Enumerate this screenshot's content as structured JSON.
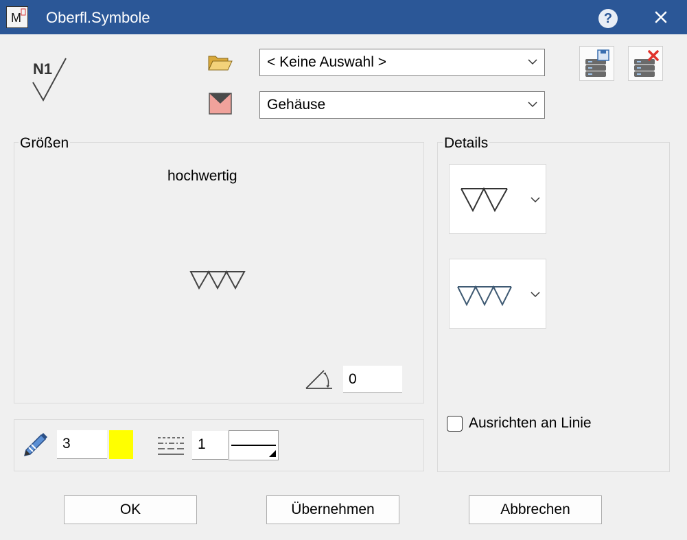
{
  "window": {
    "title": "Oberfl.Symbole",
    "help_label": "?"
  },
  "symbol_preview": {
    "label": "N1"
  },
  "selection": {
    "value": "< Keine Auswahl >"
  },
  "material": {
    "value": "Gehäuse"
  },
  "groups": {
    "sizes_label": "Größen",
    "details_label": "Details"
  },
  "sizes": {
    "quality_text": "hochwertig",
    "angle_value": "0"
  },
  "pen": {
    "width_value": "3",
    "color": "#ffff00"
  },
  "linetype": {
    "value": "1"
  },
  "details": {
    "align_checkbox_label": "Ausrichten an Linie",
    "align_checked": false
  },
  "buttons": {
    "ok": "OK",
    "apply": "Übernehmen",
    "cancel": "Abbrechen"
  }
}
